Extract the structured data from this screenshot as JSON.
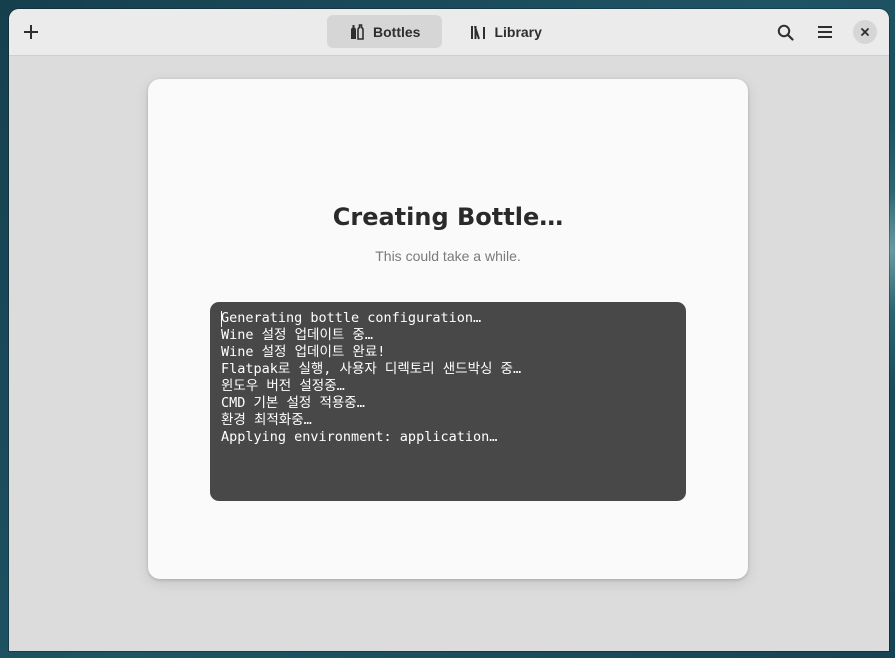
{
  "headerbar": {
    "add_icon": "plus-icon",
    "tabs": [
      {
        "label": "Bottles",
        "icon": "bottles-icon",
        "active": true
      },
      {
        "label": "Library",
        "icon": "library-icon",
        "active": false
      }
    ],
    "search_icon": "search-icon",
    "menu_icon": "hamburger-menu-icon",
    "close_icon": "close-icon"
  },
  "dialog": {
    "title": "Creating Bottle…",
    "subtitle": "This could take a while.",
    "log_lines": [
      "Generating bottle configuration…",
      "Wine 설정 업데이트 중…",
      "Wine 설정 업데이트 완료!",
      "Flatpak로 실행, 사용자 디렉토리 샌드박싱 중…",
      "윈도우 버전 설정중…",
      "CMD 기본 설정 적용중…",
      "환경 최적화중…",
      "Applying environment: application…"
    ]
  },
  "colors": {
    "headerbar_bg": "#ebebeb",
    "window_bg": "#dcdcdc",
    "dialog_bg": "#fafafa",
    "log_bg": "#484848",
    "active_tab_bg": "#d6d6d6"
  }
}
